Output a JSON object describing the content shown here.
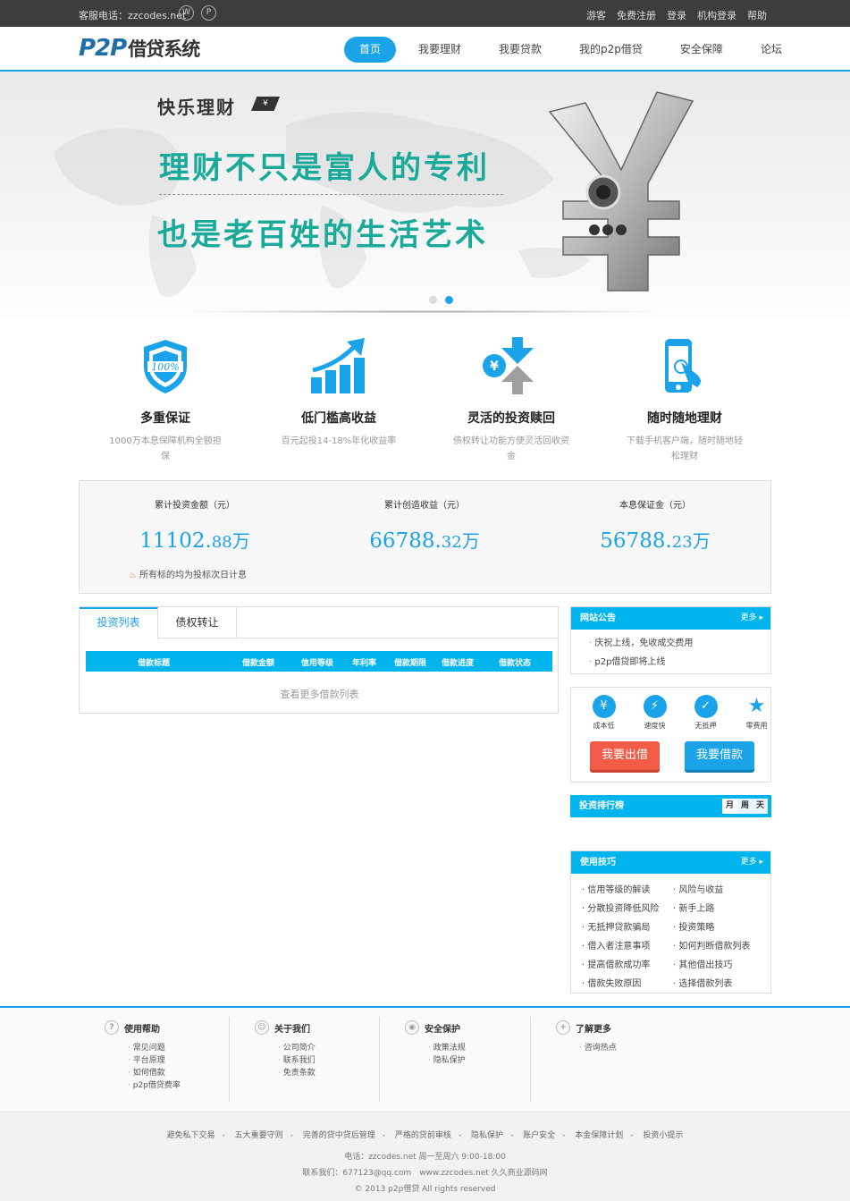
{
  "topbar": {
    "hotline": "客服电话：zzcodes.net",
    "icon1": "weibo-icon",
    "icon2": "wechat-icon",
    "links": [
      "游客",
      "免费注册",
      "登录",
      "机构登录",
      "帮助"
    ]
  },
  "header": {
    "logo_en": "P2P",
    "logo_cn": "借贷系统",
    "nav": [
      "首页",
      "我要理财",
      "我要贷款",
      "我的p2p借贷",
      "安全保障",
      "论坛"
    ],
    "active_nav": "首页"
  },
  "banner": {
    "tag": "快乐理财",
    "tag_symbol": "¥",
    "line1": "理财不只是富人的专利",
    "line2": "也是老百姓的生活艺术",
    "slide_count": 2,
    "active_slide": 2
  },
  "features": [
    {
      "icon": "shield-100-icon",
      "title": "多重保证",
      "desc": "1000万本息保障机构全额担保"
    },
    {
      "icon": "growth-chart-icon",
      "title": "低门槛高收益",
      "desc": "百元起投14-18%年化收益率"
    },
    {
      "icon": "exchange-yen-icon",
      "title": "灵活的投资赎回",
      "desc": "债权转让功能方便灵活回收资金"
    },
    {
      "icon": "mobile-touch-icon",
      "title": "随时随地理财",
      "desc": "下载手机客户端，随时随地轻松理财"
    }
  ],
  "stats": {
    "items": [
      {
        "label": "累计投资金额（元）",
        "int": "11102.",
        "dec": "88",
        "unit": "万"
      },
      {
        "label": "累计创造收益（元）",
        "int": "66788.",
        "dec": "32",
        "unit": "万"
      },
      {
        "label": "本息保证金（元）",
        "int": "56788.",
        "dec": "23",
        "unit": "万"
      }
    ],
    "note": "所有标的均为投标次日计息"
  },
  "loan_tabs": {
    "tabs": [
      "投资列表",
      "债权转让"
    ],
    "active": "投资列表",
    "columns": [
      "借款标题",
      "借款金额",
      "信用等级",
      "年利率",
      "借款期限",
      "借款进度",
      "借款状态"
    ],
    "more": "查看更多借款列表"
  },
  "notice": {
    "title": "网站公告",
    "more": "更多",
    "items": [
      "庆祝上线，免收成交费用",
      "p2p借贷即将上线"
    ]
  },
  "quick": {
    "icons": [
      {
        "icon": "yen-icon",
        "label": "成本低",
        "glyph": "¥"
      },
      {
        "icon": "lightning-icon",
        "label": "速度快",
        "glyph": "⚡"
      },
      {
        "icon": "shield-check-icon",
        "label": "无抵押",
        "glyph": "✓"
      },
      {
        "icon": "star-icon",
        "label": "零费用",
        "glyph": "★"
      }
    ],
    "lend_btn": "我要出借",
    "borrow_btn": "我要借款"
  },
  "ranking": {
    "title": "投资排行榜",
    "tabs": [
      "月",
      "周",
      "天"
    ],
    "active": "月"
  },
  "tips": {
    "title": "使用技巧",
    "more": "更多",
    "items": [
      "信用等级的解读",
      "风险与收益",
      "分散投资降低风险",
      "新手上路",
      "无抵押贷款骗局",
      "投资策略",
      "借入者注意事项",
      "如何判断借款列表",
      "提高借款成功率",
      "其他借出技巧",
      "借款失败原因",
      "选择借款列表"
    ]
  },
  "footer": {
    "cols": [
      {
        "icon": "question-icon",
        "title": "使用帮助",
        "items": [
          "常见问题",
          "平台原理",
          "如何借款",
          "p2p借贷费率"
        ]
      },
      {
        "icon": "people-icon",
        "title": "关于我们",
        "items": [
          "公司简介",
          "联系我们",
          "免责条款"
        ]
      },
      {
        "icon": "safety-icon",
        "title": "安全保护",
        "items": [
          "政策法规",
          "隐私保护"
        ]
      },
      {
        "icon": "plus-icon",
        "title": "了解更多",
        "items": [
          "咨询热点"
        ]
      }
    ],
    "links": [
      "避免私下交易",
      "五大重要守则",
      "完善的贷中贷后管理",
      "严格的贷前审核",
      "隐私保护",
      "账户安全",
      "本金保障计划",
      "投资小提示"
    ],
    "line1": "电话：zzcodes.net 周一至周六 9:00-18:00",
    "line2": "联系我们：677123@qq.com　www.zzcodes.net 久久商业源码网",
    "line3": "© 2013 p2p借贷 All rights reserved"
  }
}
